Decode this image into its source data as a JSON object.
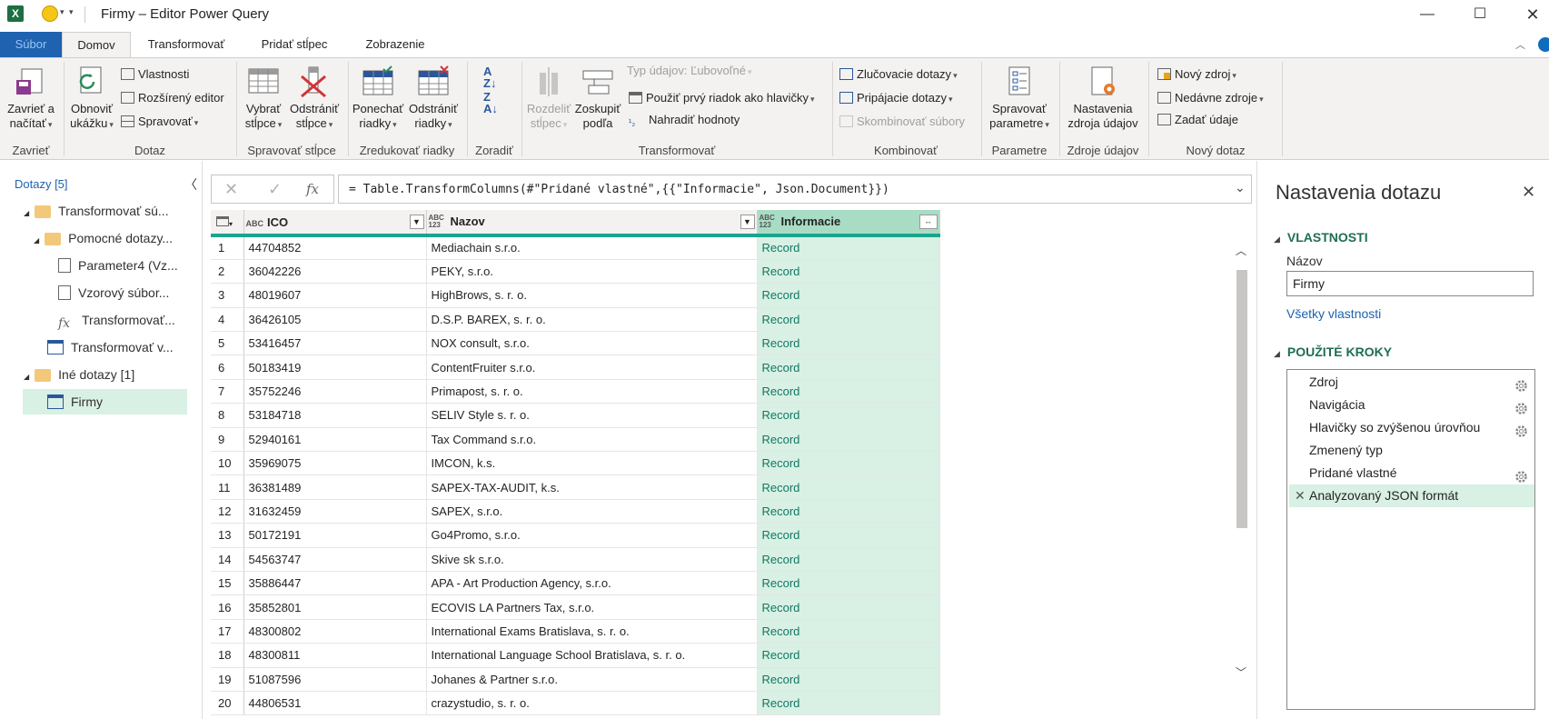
{
  "window": {
    "title": "Firmy – Editor Power Query"
  },
  "tabs": [
    "Súbor",
    "Domov",
    "Transformovať",
    "Pridať stĺpec",
    "Zobrazenie"
  ],
  "ribbon": {
    "zavriet": {
      "btn": [
        "Zavrieť a",
        "načítať"
      ],
      "label": "Zavrieť"
    },
    "dotaz": {
      "obnovit": [
        "Obnoviť",
        "ukážku"
      ],
      "vlastnosti": "Vlastnosti",
      "rozsireny": "Rozšírený editor",
      "spravovat": "Spravovať",
      "label": "Dotaz"
    },
    "stlpce": {
      "vybrat": [
        "Vybrať",
        "stĺpce"
      ],
      "odstranit": [
        "Odstrániť",
        "stĺpce"
      ],
      "label": "Spravovať stĺpce"
    },
    "riadky": {
      "ponechat": [
        "Ponechať",
        "riadky"
      ],
      "odstranit": [
        "Odstrániť",
        "riadky"
      ],
      "label": "Zredukovať riadky"
    },
    "zoradit": {
      "label": "Zoradiť"
    },
    "transformovat": {
      "rozdelit": [
        "Rozdeliť",
        "stĺpec"
      ],
      "zoskupit": [
        "Zoskupiť",
        "podľa"
      ],
      "typ": "Typ údajov: Ľubovoľné",
      "hlavicky": "Použiť prvý riadok ako hlavičky",
      "nahradit": "Nahradiť hodnoty",
      "label": "Transformovať"
    },
    "kombinovat": {
      "zlucovacie": "Zlučovacie dotazy",
      "pripajacie": "Pripájacie dotazy",
      "skombinovat": "Skombinovať súbory",
      "label": "Kombinovať"
    },
    "parametre": {
      "btn": [
        "Spravovať",
        "parametre"
      ],
      "label": "Parametre"
    },
    "zdroje": {
      "btn": [
        "Nastavenia",
        "zdroja údajov"
      ],
      "label": "Zdroje údajov"
    },
    "novy": {
      "zdroj": "Nový zdroj",
      "nedavne": "Nedávne zdroje",
      "zadat": "Zadať údaje",
      "label": "Nový dotaz"
    }
  },
  "queries": {
    "header": "Dotazy [5]",
    "items": [
      {
        "label": "Transformovať sú..."
      },
      {
        "label": "Pomocné dotazy..."
      },
      {
        "label": "Parameter4 (Vz..."
      },
      {
        "label": "Vzorový súbor..."
      },
      {
        "label": "Transformovať..."
      },
      {
        "label": "Transformovať v..."
      },
      {
        "label": "Iné dotazy [1]"
      },
      {
        "label": "Firmy"
      }
    ]
  },
  "formula": "= Table.TransformColumns(#\"Pridané vlastné\",{{\"Informacie\", Json.Document}})",
  "grid": {
    "columns": [
      {
        "name": "ICO",
        "type": "ABC"
      },
      {
        "name": "Nazov",
        "type": "ABC 123"
      },
      {
        "name": "Informacie",
        "type": "ABC 123"
      }
    ],
    "rows": [
      [
        "1",
        "44704852",
        "Mediachain s.r.o.",
        "Record"
      ],
      [
        "2",
        "36042226",
        "PEKY, s.r.o.",
        "Record"
      ],
      [
        "3",
        "48019607",
        "HighBrows, s. r. o.",
        "Record"
      ],
      [
        "4",
        "36426105",
        "D.S.P. BAREX, s. r. o.",
        "Record"
      ],
      [
        "5",
        "53416457",
        "NOX consult, s.r.o.",
        "Record"
      ],
      [
        "6",
        "50183419",
        "ContentFruiter s.r.o.",
        "Record"
      ],
      [
        "7",
        "35752246",
        "Primapost, s. r. o.",
        "Record"
      ],
      [
        "8",
        "53184718",
        "SELIV Style s. r. o.",
        "Record"
      ],
      [
        "9",
        "52940161",
        "Tax Command s.r.o.",
        "Record"
      ],
      [
        "10",
        "35969075",
        "IMCON, k.s.",
        "Record"
      ],
      [
        "11",
        "36381489",
        "SAPEX-TAX-AUDIT, k.s.",
        "Record"
      ],
      [
        "12",
        "31632459",
        "SAPEX, s.r.o.",
        "Record"
      ],
      [
        "13",
        "50172191",
        "Go4Promo, s.r.o.",
        "Record"
      ],
      [
        "14",
        "54563747",
        "Skive sk s.r.o.",
        "Record"
      ],
      [
        "15",
        "35886447",
        "APA - Art Production Agency, s.r.o.",
        "Record"
      ],
      [
        "16",
        "35852801",
        "ECOVIS LA Partners Tax, s.r.o.",
        "Record"
      ],
      [
        "17",
        "48300802",
        "International Exams Bratislava, s. r. o.",
        "Record"
      ],
      [
        "18",
        "48300811",
        "International Language School Bratislava, s. r. o.",
        "Record"
      ],
      [
        "19",
        "51087596",
        "Johanes & Partner s.r.o.",
        "Record"
      ],
      [
        "20",
        "44806531",
        "crazystudio, s. r. o.",
        "Record"
      ]
    ]
  },
  "settings": {
    "title": "Nastavenia dotazu",
    "properties_header": "VLASTNOSTI",
    "name_label": "Názov",
    "name_value": "Firmy",
    "all_props": "Všetky vlastnosti",
    "steps_header": "POUŽITÉ KROKY",
    "steps": [
      "Zdroj",
      "Navigácia",
      "Hlavičky so zvýšenou úrovňou",
      "Zmenený typ",
      "Pridané vlastné",
      "Analyzovaný JSON formát"
    ]
  }
}
